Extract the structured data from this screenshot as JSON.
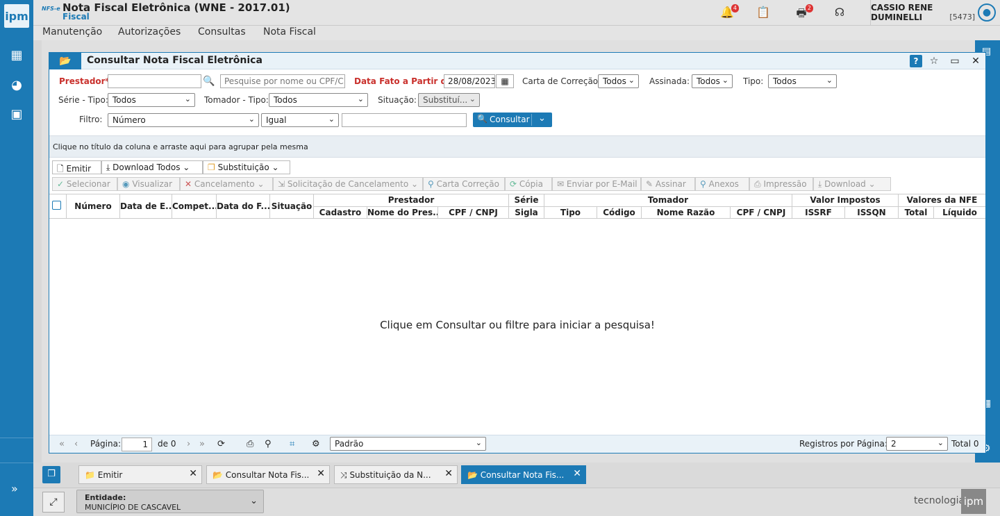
{
  "colors": {
    "brand": "#1c7ab5",
    "required": "#c9302c"
  },
  "leftbar": {
    "logo": "ipm",
    "items": [
      "calculator-icon",
      "pie-chart-icon",
      "monitor-user-icon"
    ],
    "expand": "»"
  },
  "app": {
    "badge": "NFS-e",
    "title": "Nota Fiscal Eletrônica (WNE - 2017.01)",
    "subtitle": "Fiscal"
  },
  "notifications": {
    "bell_count": "4",
    "printer_count": "2"
  },
  "user": {
    "name": "CASSIO RENE DUMINELLI",
    "code": "[5473]"
  },
  "menu": [
    "Manutenção",
    "Autorizações",
    "Consultas",
    "Nota Fiscal"
  ],
  "dialog": {
    "title": "Consultar Nota Fiscal Eletrônica",
    "help": "?",
    "filters": {
      "prestador_label": "Prestador*",
      "prestador_placeholder": "Pesquise por nome ou CPF/CNPJ",
      "data_label": "Data Fato a Partir de*",
      "data_value": "28/08/2023",
      "carta_label": "Carta de Correção:",
      "carta_value": "Todos",
      "assinada_label": "Assinada:",
      "assinada_value": "Todos",
      "tipo_label": "Tipo:",
      "tipo_value": "Todos",
      "serie_label": "Série - Tipo:",
      "serie_value": "Todos",
      "tomador_label": "Tomador - Tipo:",
      "tomador_value": "Todos",
      "situacao_label": "Situação:",
      "situacao_value": "Substituí...",
      "filtro_label": "Filtro:",
      "filtro_field": "Número",
      "filtro_op": "Igual",
      "filtro_value": "",
      "consultar": "Consultar"
    },
    "group_hint": "Clique no título da coluna e arraste aqui para agrupar pela mesma",
    "toolbar1": [
      "Emitir",
      "Download Todos",
      "Substituição"
    ],
    "toolbar2": [
      "Selecionar",
      "Visualizar",
      "Cancelamento",
      "Solicitação de Cancelamento",
      "Carta Correção",
      "Cópia",
      "Enviar por E-Mail",
      "Assinar",
      "Anexos",
      "Impressão",
      "Download"
    ],
    "columns": {
      "numero": "Número",
      "data_e": "Data de E...",
      "compet": "Compet...",
      "data_f": "Data do F...",
      "situacao": "Situação",
      "prestador": "Prestador",
      "p_cadastro": "Cadastro",
      "p_nome": "Nome do Pres...",
      "p_cpf": "CPF / CNPJ",
      "serie": "Série",
      "serie_sigla": "Sigla",
      "tomador": "Tomador",
      "t_tipo": "Tipo",
      "t_codigo": "Código",
      "t_nome": "Nome Razão",
      "t_cpf": "CPF / CNPJ",
      "valor_impostos": "Valor Impostos",
      "issrf": "ISSRF",
      "issqn": "ISSQN",
      "valores_nfe": "Valores da NFE",
      "total": "Total",
      "liquido": "Líquido"
    },
    "empty_message": "Clique em Consultar ou filtre para iniciar a pesquisa!",
    "footer": {
      "page_label": "Página:",
      "page_value": "1",
      "of_label": "de 0",
      "layout": "Padrão",
      "per_page_label": "Registros por Página:",
      "per_page_value": "2",
      "total": "Total 0"
    }
  },
  "tabs": [
    {
      "label": "Emitir",
      "active": false
    },
    {
      "label": "Consultar Nota Fis...",
      "active": false
    },
    {
      "label": "Substituição da N...",
      "active": false
    },
    {
      "label": "Consultar Nota Fis...",
      "active": true
    }
  ],
  "entity": {
    "label": "Entidade:",
    "value": "MUNICÍPIO DE CASCAVEL"
  },
  "brand_footer": {
    "text": "tecnologia",
    "logo": "ipm"
  }
}
